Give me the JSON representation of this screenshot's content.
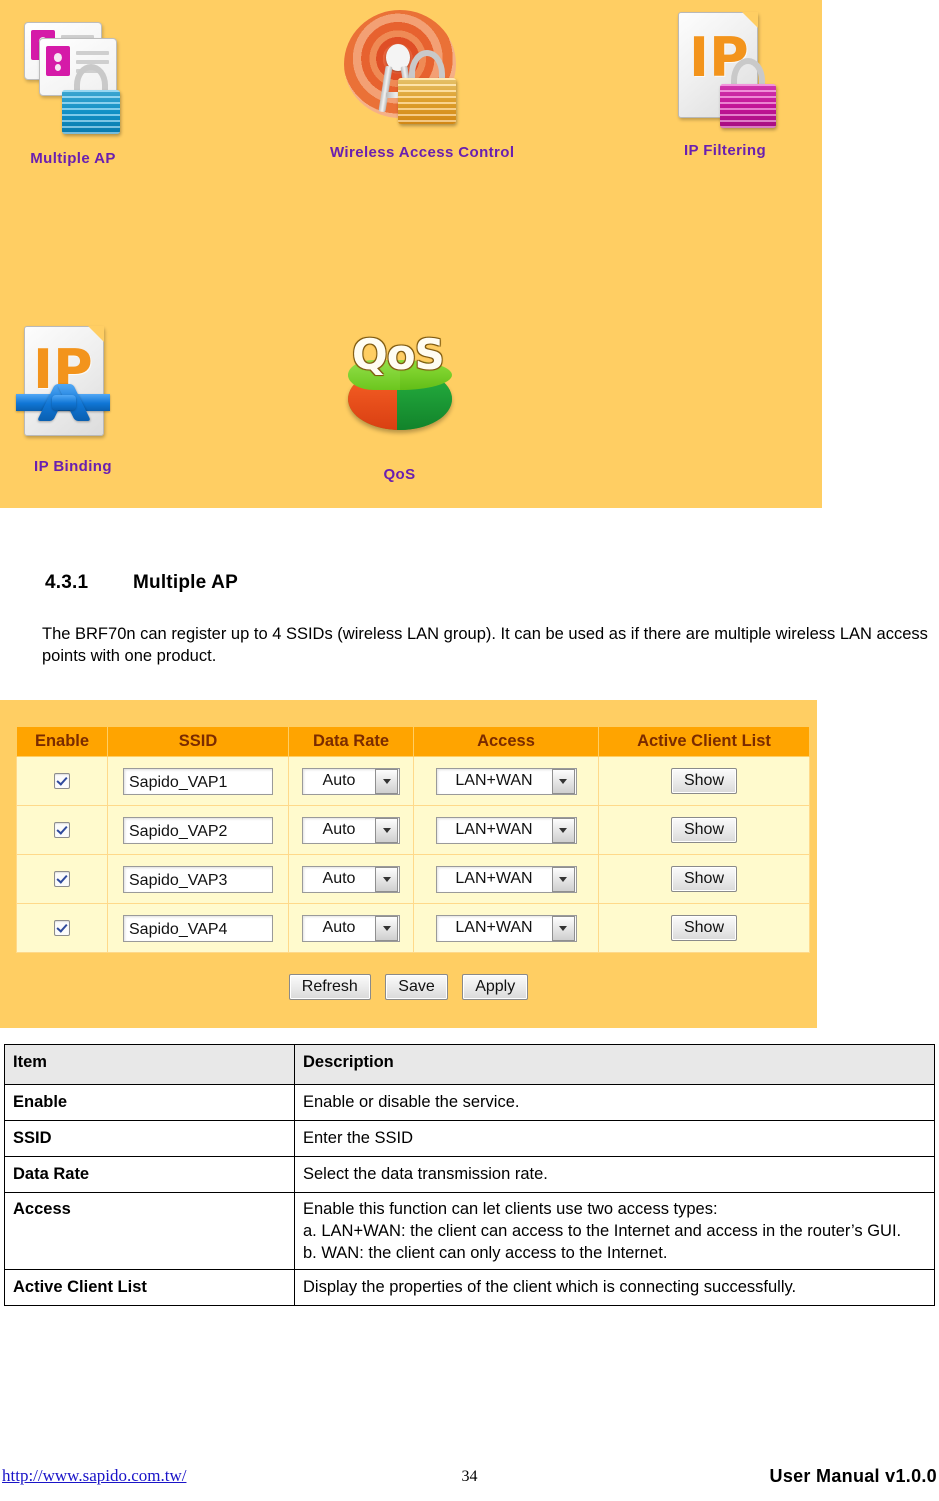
{
  "icon_panel": {
    "background_color": "#ffce63",
    "label_color": "#6a1fb0",
    "icons": [
      {
        "label": "Multiple AP",
        "icon_name": "id-cards-blue-lock-icon"
      },
      {
        "label": "Wireless Access Control",
        "icon_name": "wireless-signal-gold-lock-icon"
      },
      {
        "label": "IP Filtering",
        "icon_name": "ip-document-magenta-lock-icon"
      },
      {
        "label": "IP Binding",
        "icon_name": "ip-document-blue-chain-icon"
      },
      {
        "label": "QoS",
        "icon_name": "qos-pie-disc-icon"
      }
    ]
  },
  "section": {
    "number": "4.3.1",
    "title": "Multiple AP",
    "paragraph": "The BRF70n can register up to 4 SSIDs (wireless LAN group).    It can be used as if there are multiple wireless LAN access points with one product."
  },
  "gui": {
    "background_color": "#ffce63",
    "header_color": "#ffa400",
    "row_color": "#fffacd",
    "columns": [
      "Enable",
      "SSID",
      "Data Rate",
      "Access",
      "Active Client List"
    ],
    "rows": [
      {
        "enable": true,
        "ssid": "Sapido_VAP1",
        "data_rate": "Auto",
        "access": "LAN+WAN",
        "action": "Show"
      },
      {
        "enable": true,
        "ssid": "Sapido_VAP2",
        "data_rate": "Auto",
        "access": "LAN+WAN",
        "action": "Show"
      },
      {
        "enable": true,
        "ssid": "Sapido_VAP3",
        "data_rate": "Auto",
        "access": "LAN+WAN",
        "action": "Show"
      },
      {
        "enable": true,
        "ssid": "Sapido_VAP4",
        "data_rate": "Auto",
        "access": "LAN+WAN",
        "action": "Show"
      }
    ],
    "buttons": {
      "refresh": "Refresh",
      "save": "Save",
      "apply": "Apply"
    }
  },
  "desc_table": {
    "headers": [
      "Item",
      "Description"
    ],
    "rows": [
      {
        "item": "Enable",
        "desc": "Enable or disable the service."
      },
      {
        "item": "SSID",
        "desc": "Enter the SSID"
      },
      {
        "item": "Data Rate",
        "desc": "Select the data transmission rate."
      },
      {
        "item": "Access",
        "desc": "Enable this function can let clients use two access types:\na. LAN+WAN: the client can access to the Internet and access in the router’s GUI.\nb. WAN: the client can only access to the Internet."
      },
      {
        "item": "Active Client List",
        "desc": "Display the properties of the client which is connecting successfully."
      }
    ]
  },
  "footer": {
    "url": "http://www.sapido.com.tw/",
    "page_number": "34",
    "version": "User  Manual  v1.0.0"
  }
}
